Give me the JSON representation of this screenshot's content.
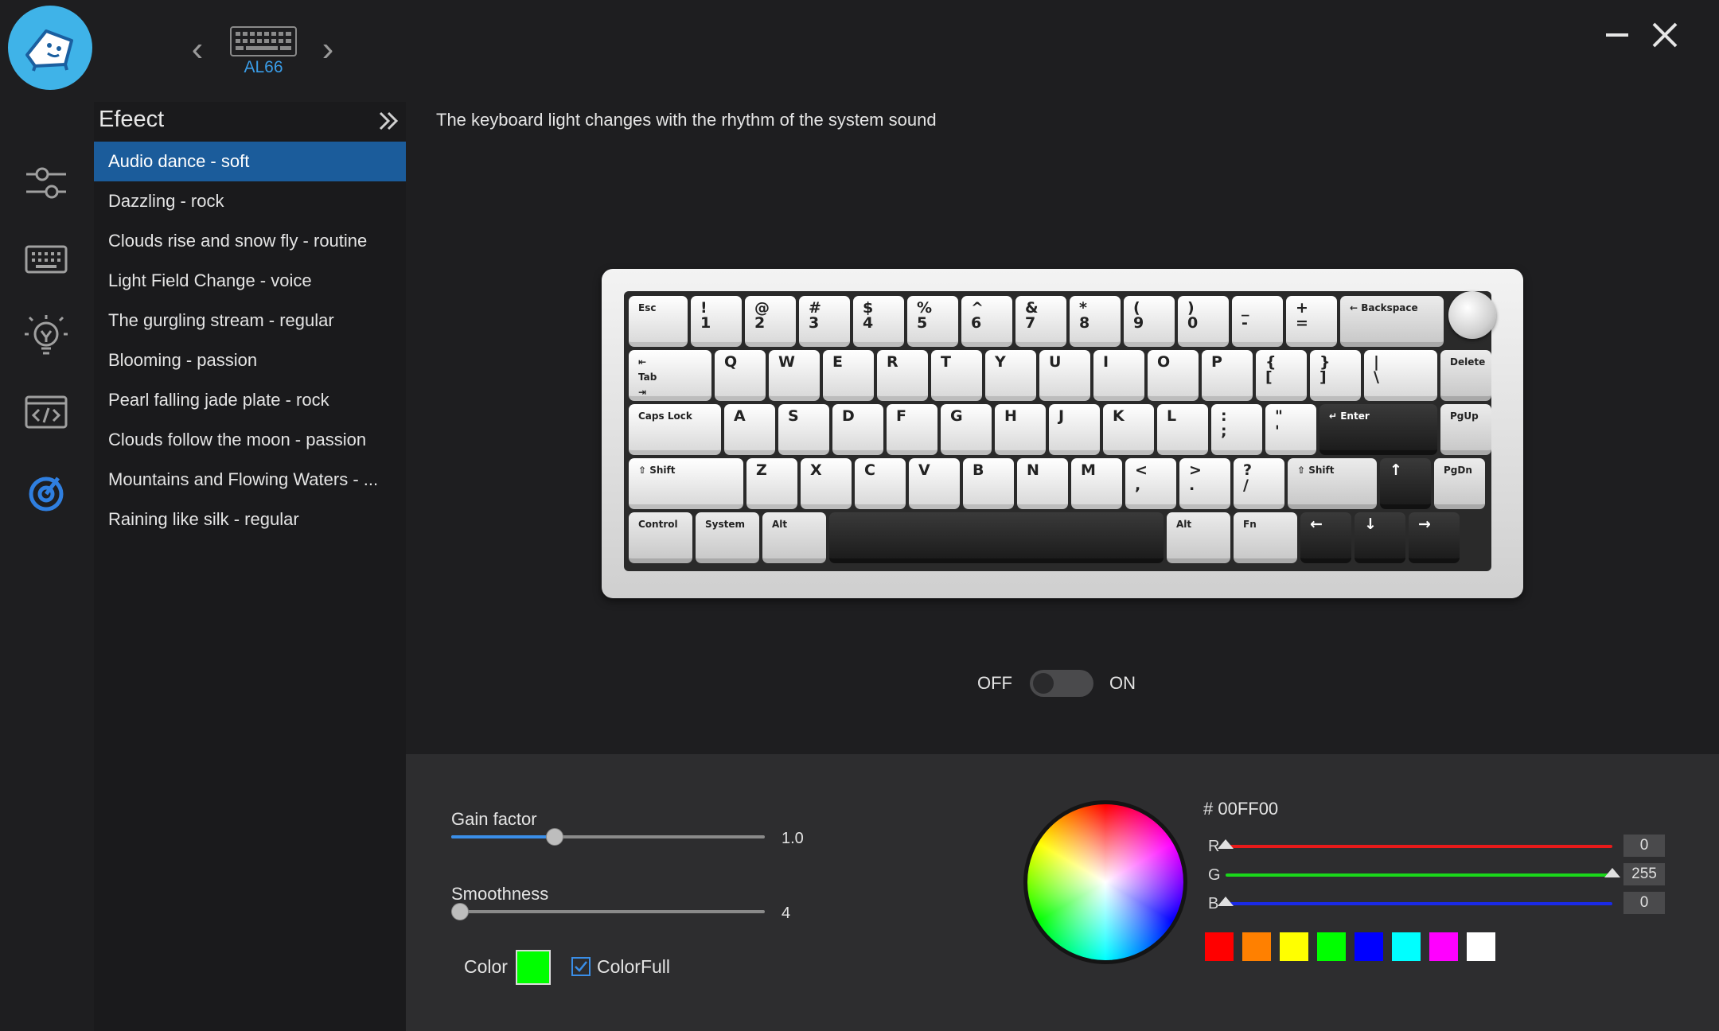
{
  "device": {
    "name": "AL66"
  },
  "effects": {
    "title": "Efeect",
    "items": [
      "Audio dance - soft",
      "Dazzling - rock",
      "Clouds rise and snow fly - routine",
      "Light Field Change - voice",
      "The gurgling stream - regular",
      "Blooming - passion",
      "Pearl falling jade plate - rock",
      "Clouds follow the moon - passion",
      "Mountains and Flowing Waters - ...",
      "Raining like silk - regular"
    ],
    "selected_index": 0
  },
  "description": "The keyboard light changes with the rhythm of the system sound",
  "keyboard": {
    "rows": [
      [
        [
          "Esc",
          "small"
        ],
        [
          "!\n1",
          ""
        ],
        [
          "@\n2",
          ""
        ],
        [
          "#\n3",
          ""
        ],
        [
          "$\n4",
          ""
        ],
        [
          "%\n5",
          ""
        ],
        [
          "^\n6",
          ""
        ],
        [
          "&\n7",
          ""
        ],
        [
          "*\n8",
          ""
        ],
        [
          "(\n9",
          ""
        ],
        [
          ")\n0",
          ""
        ],
        [
          "_\n-",
          ""
        ],
        [
          "+\n=",
          ""
        ],
        [
          "← Backspace",
          "small"
        ]
      ],
      [
        [
          "⇤\nTab\n⇥",
          "small"
        ],
        [
          "Q",
          ""
        ],
        [
          "W",
          ""
        ],
        [
          "E",
          ""
        ],
        [
          "R",
          ""
        ],
        [
          "T",
          ""
        ],
        [
          "Y",
          ""
        ],
        [
          "U",
          ""
        ],
        [
          "I",
          ""
        ],
        [
          "O",
          ""
        ],
        [
          "P",
          ""
        ],
        [
          "{\n[",
          ""
        ],
        [
          "}\n]",
          ""
        ],
        [
          "|\n\\",
          ""
        ],
        [
          "Delete",
          "small"
        ]
      ],
      [
        [
          "Caps Lock",
          "small"
        ],
        [
          "A",
          ""
        ],
        [
          "S",
          ""
        ],
        [
          "D",
          ""
        ],
        [
          "F",
          ""
        ],
        [
          "G",
          ""
        ],
        [
          "H",
          ""
        ],
        [
          "J",
          ""
        ],
        [
          "K",
          ""
        ],
        [
          "L",
          ""
        ],
        [
          ":\n;",
          ""
        ],
        [
          "\"\n'",
          ""
        ],
        [
          "↵ Enter",
          "small"
        ],
        [
          "PgUp",
          "small"
        ]
      ],
      [
        [
          "⇧ Shift",
          "small"
        ],
        [
          "Z",
          ""
        ],
        [
          "X",
          ""
        ],
        [
          "C",
          ""
        ],
        [
          "V",
          ""
        ],
        [
          "B",
          ""
        ],
        [
          "N",
          ""
        ],
        [
          "M",
          ""
        ],
        [
          "<\n,",
          ""
        ],
        [
          ">\n.",
          ""
        ],
        [
          "?\n/",
          ""
        ],
        [
          "⇧ Shift",
          "small"
        ],
        [
          "↑",
          ""
        ],
        [
          "PgDn",
          "small"
        ]
      ],
      [
        [
          "Control",
          "small"
        ],
        [
          "System",
          "small"
        ],
        [
          "Alt",
          "small"
        ],
        [
          "",
          ""
        ],
        [
          "Alt",
          "small"
        ],
        [
          "Fn",
          "small"
        ],
        [
          "←",
          ""
        ],
        [
          "↓",
          ""
        ],
        [
          "→",
          ""
        ]
      ]
    ]
  },
  "toggle": {
    "off_label": "OFF",
    "on_label": "ON",
    "state": "off"
  },
  "gain": {
    "label": "Gain factor",
    "value": "1.0",
    "fraction": 0.33
  },
  "smoothness": {
    "label": "Smoothness",
    "value": "4",
    "fraction": 0.0
  },
  "color": {
    "label": "Color",
    "current": "#00ff00"
  },
  "colorfull": {
    "label": "ColorFull",
    "checked": true
  },
  "picker": {
    "hex": "# 00FF00",
    "r": {
      "label": "R",
      "value": "0",
      "color": "#e81a1a"
    },
    "g": {
      "label": "G",
      "value": "255",
      "color": "#1ad81a"
    },
    "b": {
      "label": "B",
      "value": "0",
      "color": "#1a2ae8"
    },
    "presets": [
      "#ff0000",
      "#ff8000",
      "#ffff00",
      "#00ff00",
      "#0000ff",
      "#00ffff",
      "#ff00ff",
      "#ffffff"
    ]
  },
  "icons": {
    "logo": "mascot-logo-icon",
    "rail": [
      "sliders-icon",
      "keyboard-icon",
      "lightbulb-icon",
      "code-icon",
      "audio-effect-icon"
    ]
  }
}
